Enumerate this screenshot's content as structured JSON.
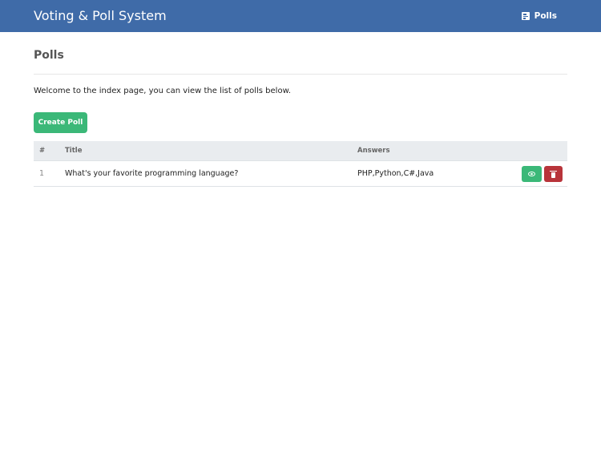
{
  "header": {
    "brand": "Voting & Poll System",
    "nav_link": {
      "label": "Polls",
      "icon": "poll-icon"
    },
    "background": "#3f6ba8"
  },
  "main": {
    "title": "Polls",
    "intro": "Welcome to the index page, you can view the list of polls below.",
    "create_button": {
      "label": "Create Poll",
      "color": "#3bb878"
    },
    "table": {
      "columns": [
        "#",
        "Title",
        "Answers",
        ""
      ],
      "rows": [
        {
          "num": "1",
          "title": "What's your favorite programming language?",
          "answers": "PHP,Python,C#,Java",
          "actions": [
            {
              "icon": "eye-icon",
              "color": "#3bb878"
            },
            {
              "icon": "trash-icon",
              "color": "#b8343a"
            }
          ]
        }
      ]
    }
  }
}
